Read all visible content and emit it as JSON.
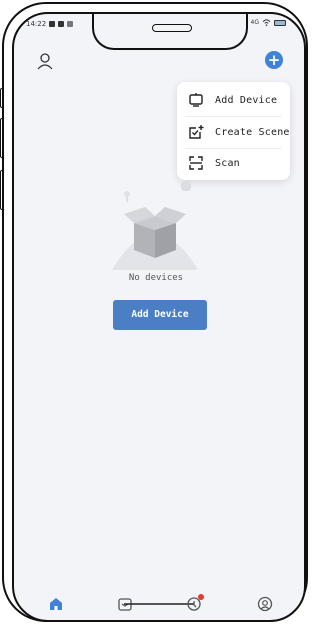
{
  "status_bar": {
    "time": "14:22",
    "network": "4G"
  },
  "header": {
    "profile_icon": "person-icon",
    "add_icon": "plus-circle-icon"
  },
  "menu": {
    "items": [
      {
        "label": "Add Device",
        "icon": "device-icon"
      },
      {
        "label": "Create Scene",
        "icon": "scene-icon"
      },
      {
        "label": "Scan",
        "icon": "scan-icon"
      }
    ]
  },
  "empty_state": {
    "text": "No devices",
    "button_label": "Add Device"
  },
  "bottom_nav": {
    "items": [
      {
        "icon": "home-icon",
        "active": true
      },
      {
        "icon": "scene-icon"
      },
      {
        "icon": "smart-icon",
        "badge": true
      },
      {
        "icon": "profile-icon"
      }
    ]
  },
  "colors": {
    "accent": "#3f82d6",
    "button": "#4a7fc6",
    "background": "#f3f4f8",
    "badge": "#e53935"
  }
}
